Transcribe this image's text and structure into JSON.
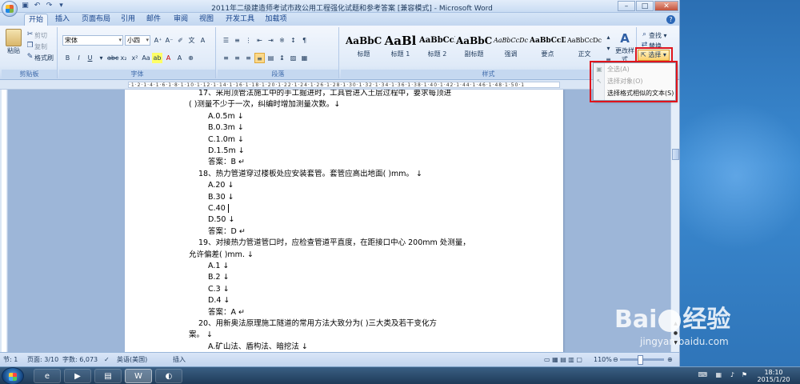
{
  "window": {
    "title": "2011年二级建造师考试市政公用工程强化试题和参考答案 [兼容模式] - Microsoft Word",
    "controls": [
      "–",
      "□",
      "✕"
    ]
  },
  "tabs": [
    "开始",
    "插入",
    "页面布局",
    "引用",
    "邮件",
    "审阅",
    "视图",
    "开发工具",
    "加载项"
  ],
  "ribbon": {
    "clipboard": {
      "paste": "粘贴",
      "cut": "剪切",
      "copy": "复制",
      "format_painter": "格式刷",
      "label": "剪贴板"
    },
    "font": {
      "name": "宋体",
      "size": "小四",
      "label": "字体"
    },
    "paragraph": {
      "label": "段落"
    },
    "styles": {
      "label": "样式",
      "items": [
        {
          "sample": "AaBbC",
          "name": "标题"
        },
        {
          "sample": "AaBl",
          "name": "标题 1"
        },
        {
          "sample": "AaBbCcI",
          "name": "标题 2"
        },
        {
          "sample": "AaBbC",
          "name": "副标题"
        },
        {
          "sample": "AaBbCcDc",
          "name": "强调"
        },
        {
          "sample": "AaBbCcD",
          "name": "要点"
        },
        {
          "sample": "AaBbCcDc",
          "name": "正文"
        }
      ],
      "change_styles": "更改样式"
    },
    "editing": {
      "find": "查找",
      "replace": "替换",
      "select": "选择"
    }
  },
  "select_menu": {
    "items": [
      {
        "label": "全选(A)",
        "disabled": true
      },
      {
        "label": "选择对象(O)",
        "disabled": true
      },
      {
        "label": "选择格式相似的文本(S)",
        "disabled": false
      }
    ]
  },
  "document": {
    "lines": [
      {
        "text": "17、采用顶管法施工中的手工掘进时，工具管进入土层过程中，要求每顶进",
        "style": "firstline"
      },
      {
        "text": "(   )测量不少于一次，纠编时增加测量次数。↓",
        "style": "hang"
      },
      {
        "text": "A.0.5m ↓",
        "style": "indent"
      },
      {
        "text": "B.0.3m ↓",
        "style": "indent"
      },
      {
        "text": "C.1.0m ↓",
        "style": "indent"
      },
      {
        "text": "D.1.5m ↓",
        "style": "indent"
      },
      {
        "text": "答案：B ↵",
        "style": "indent"
      },
      {
        "text": "18、热力管道穿过楼板处应安装套管。套管应高出地面(   )mm。 ↓",
        "style": "firstline"
      },
      {
        "text": "A.20 ↓",
        "style": "indent"
      },
      {
        "text": "B.30 ↓",
        "style": "indent"
      },
      {
        "text": "C.40 ",
        "style": "indent",
        "cursor": true
      },
      {
        "text": "D.50 ↓",
        "style": "indent"
      },
      {
        "text": "答案：D ↵",
        "style": "indent"
      },
      {
        "text": "19、对接热力管道管口时，应检查管道平直度，在距接口中心 200mm 处测量，",
        "style": "firstline"
      },
      {
        "text": "允许偏差(   )mm. ↓",
        "style": "hang"
      },
      {
        "text": "A.1 ↓",
        "style": "indent"
      },
      {
        "text": "B.2 ↓",
        "style": "indent"
      },
      {
        "text": "C.3 ↓",
        "style": "indent"
      },
      {
        "text": "D.4 ↓",
        "style": "indent"
      },
      {
        "text": "答案：A ↵",
        "style": "indent"
      },
      {
        "text": "20、用新奥法原理施工隧道的常用方法大致分为(   )三大类及若干变化方",
        "style": "firstline"
      },
      {
        "text": "案。 ↓",
        "style": "hang"
      },
      {
        "text": "A.矿山法、盾构法、暗挖法 ↓",
        "style": "indent"
      }
    ]
  },
  "statusbar": {
    "section": "节: 1",
    "page": "页面: 3/10",
    "words": "字数: 6,073",
    "language": "英语(美国)",
    "mode": "插入",
    "zoom": "110%"
  },
  "taskbar": {
    "time": "18:10",
    "date": "2015/1/20"
  },
  "watermark": {
    "brand_left": "Bai",
    "brand_right": "经验",
    "url": "jingyan.baidu.com"
  },
  "colors": {
    "highlight_box": "#e0141b",
    "ribbon": "#dfeaf8",
    "select_active": "#fccf6b"
  }
}
